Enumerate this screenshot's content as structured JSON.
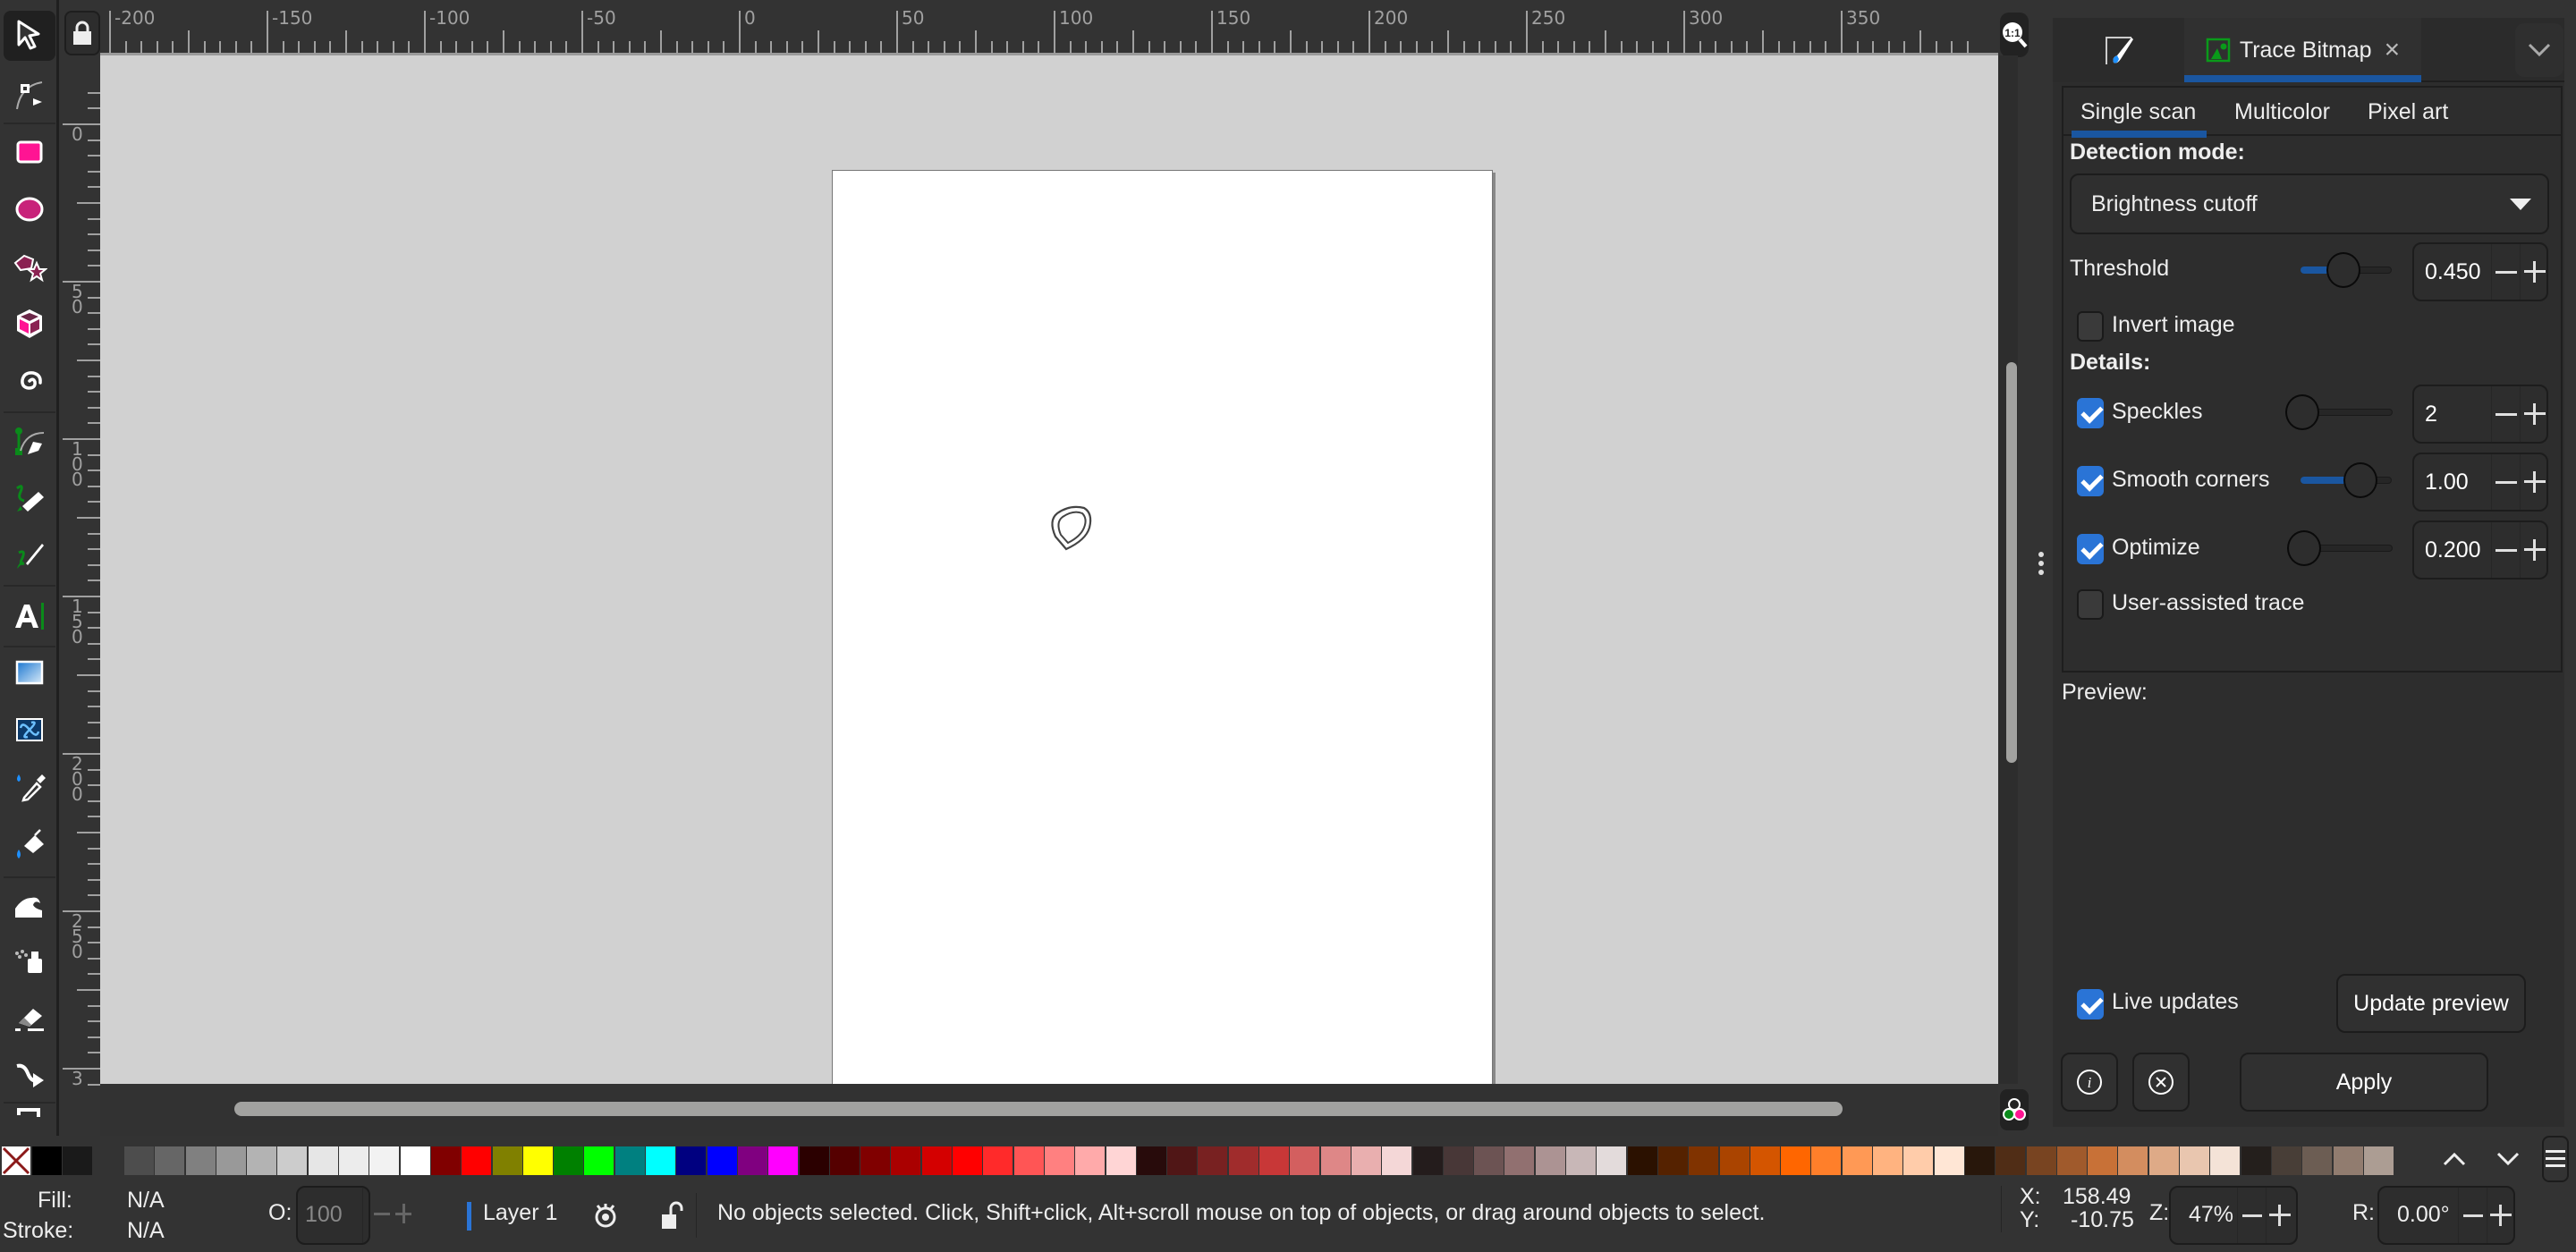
{
  "toolbox": {
    "tools": [
      {
        "name": "selector-tool",
        "icon": "pointer-arrow-icon",
        "active": true
      },
      {
        "name": "node-tool",
        "icon": "node-edit-icon"
      },
      {
        "name": "rectangle-tool",
        "icon": "rectangle-icon"
      },
      {
        "name": "ellipse-tool",
        "icon": "ellipse-icon"
      },
      {
        "name": "star-polygon-tool",
        "icon": "star-polygon-icon"
      },
      {
        "name": "3d-box-tool",
        "icon": "3d-box-icon"
      },
      {
        "name": "spiral-tool",
        "icon": "spiral-icon"
      },
      {
        "name": "pen-tool",
        "icon": "pen-bezier-icon"
      },
      {
        "name": "pencil-tool",
        "icon": "pencil-icon"
      },
      {
        "name": "calligraphy-tool",
        "icon": "calligraphy-icon"
      },
      {
        "name": "text-tool",
        "icon": "text-icon"
      },
      {
        "name": "gradient-tool",
        "icon": "gradient-icon"
      },
      {
        "name": "mesh-tool",
        "icon": "mesh-icon"
      },
      {
        "name": "dropper-tool",
        "icon": "dropper-icon"
      },
      {
        "name": "paint-bucket-tool",
        "icon": "paint-bucket-icon"
      },
      {
        "name": "tweak-tool",
        "icon": "tweak-wave-icon"
      },
      {
        "name": "spray-tool",
        "icon": "spray-can-icon"
      },
      {
        "name": "eraser-tool",
        "icon": "eraser-icon"
      },
      {
        "name": "connector-tool",
        "icon": "connector-icon"
      }
    ]
  },
  "rulers": {
    "horizontal_labels": [
      "-200",
      "-150",
      "-100",
      "-50",
      "0",
      "50",
      "100",
      "150",
      "200",
      "250",
      "300",
      "350"
    ],
    "vertical_labels": [
      "0",
      "50",
      "100",
      "150",
      "200",
      "250",
      "3"
    ]
  },
  "canvas": {
    "zoom_1to1_label": "1:1"
  },
  "dock": {
    "tabs": [
      {
        "label": "",
        "icon": "fill-stroke-icon"
      },
      {
        "label": "Trace Bitmap",
        "icon": "trace-bitmap-icon",
        "active": true,
        "close": "×"
      }
    ],
    "menu_icon": "chevron-down-icon"
  },
  "trace": {
    "subtabs": [
      "Single scan",
      "Multicolor",
      "Pixel art"
    ],
    "active_subtab": "Single scan",
    "detection_mode_label": "Detection mode:",
    "detection_mode_value": "Brightness cutoff",
    "threshold": {
      "label": "Threshold",
      "value": "0.450",
      "slider_fraction": 0.45
    },
    "invert_image": {
      "label": "Invert image",
      "checked": false
    },
    "details_label": "Details:",
    "speckles": {
      "label": "Speckles",
      "checked": true,
      "value": "2",
      "slider_fraction": 0.0
    },
    "smooth_corners": {
      "label": "Smooth corners",
      "checked": true,
      "value": "1.00",
      "slider_fraction": 0.75
    },
    "optimize": {
      "label": "Optimize",
      "checked": true,
      "value": "0.200",
      "slider_fraction": 0.0
    },
    "user_assisted": {
      "label": "User-assisted trace",
      "checked": false
    },
    "preview_label": "Preview:",
    "live_updates": {
      "label": "Live updates",
      "checked": true
    },
    "update_preview_label": "Update preview",
    "apply_label": "Apply"
  },
  "palette": {
    "colors": [
      "#000000",
      "#1a1a1a",
      "#333333",
      "#4d4d4d",
      "#666666",
      "#808080",
      "#999999",
      "#b3b3b3",
      "#cccccc",
      "#e6e6e6",
      "#ececec",
      "#f2f2f2",
      "#ffffff",
      "#800000",
      "#ff0000",
      "#808000",
      "#ffff00",
      "#008000",
      "#00ff00",
      "#008080",
      "#00ffff",
      "#000080",
      "#0000ff",
      "#800080",
      "#ff00ff",
      "#2b0000",
      "#550000",
      "#800000",
      "#aa0000",
      "#d40000",
      "#ff0000",
      "#ff2a2a",
      "#ff5555",
      "#ff8080",
      "#ffaaaa",
      "#ffd5d5",
      "#280b0b",
      "#501616",
      "#782121",
      "#a02c2c",
      "#c83737",
      "#d35f5f",
      "#de8787",
      "#e9afaf",
      "#f4d7d7",
      "#241c1c",
      "#483737",
      "#6c5353",
      "#917070",
      "#ac9393",
      "#c8b7b7",
      "#e3dbdb",
      "#2b1100",
      "#552200",
      "#803300",
      "#aa4400",
      "#d45500",
      "#ff6600",
      "#ff7f2a",
      "#ff9955",
      "#ffb380",
      "#ffccaa",
      "#ffe6d5",
      "#28170b",
      "#502d16",
      "#784421",
      "#a05a2c",
      "#c87137",
      "#d38d5f",
      "#deaa87",
      "#e9c6af",
      "#f4e3d7",
      "#241f1c",
      "#483e37",
      "#6c5d53",
      "#917c6f",
      "#ac9d93"
    ]
  },
  "status": {
    "fill_label": "Fill:",
    "fill_value": "N/A",
    "stroke_label": "Stroke:",
    "stroke_value": "N/A",
    "opacity_label": "O:",
    "opacity_value": "100",
    "layer_name": "Layer 1",
    "message": "No objects selected. Click, Shift+click, Alt+scroll mouse on top of objects, or drag around objects to select.",
    "x_label": "X:",
    "x_value": "158.49",
    "y_label": "Y:",
    "y_value": "-10.75",
    "zoom_label": "Z:",
    "zoom_value": "47%",
    "rotation_label": "R:",
    "rotation_value": "0.00°"
  },
  "colors": {
    "accent": "#1a56a0",
    "checkbox_on": "#2a74d6",
    "canvas_bg": "#d1d1d1",
    "panel_bg": "#2d2d2d"
  }
}
